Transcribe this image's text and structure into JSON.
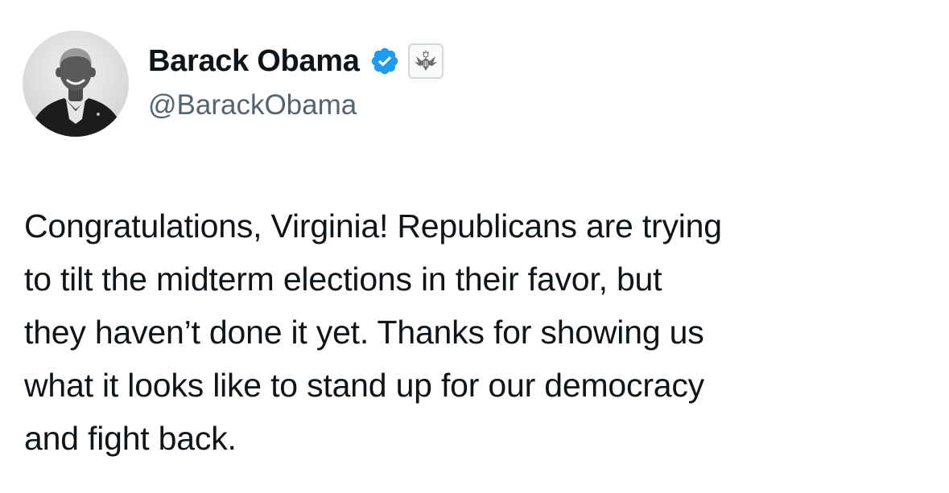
{
  "author": {
    "display_name": "Barack Obama",
    "handle": "@BarackObama",
    "verified_icon": "verified-checkmark-icon",
    "affiliate_icon": "government-seal-icon",
    "verified_color": "#1d9bf0"
  },
  "tweet": {
    "lines": [
      "Congratulations, Virginia! Republicans are trying",
      "to tilt the midterm elections in their favor, but",
      "they haven’t done it yet. Thanks for showing us",
      "what it looks like to stand up for our democracy",
      "and fight back."
    ]
  },
  "colors": {
    "text": "#0f1419",
    "secondary_text": "#536471",
    "background": "#ffffff"
  }
}
